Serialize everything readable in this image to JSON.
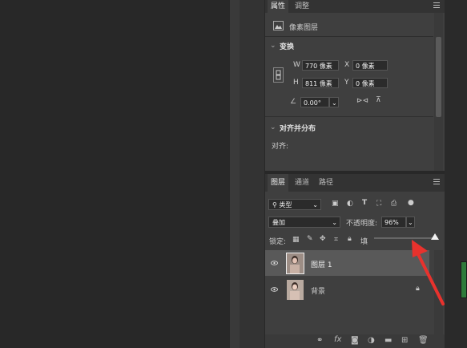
{
  "properties_panel": {
    "tabs": [
      "属性",
      "调整"
    ],
    "layer_kind": "像素图层",
    "transform_title": "变换",
    "w_label": "W",
    "w_value": "770 像素",
    "x_label": "X",
    "x_value": "0 像素",
    "h_label": "H",
    "h_value": "811 像素",
    "y_label": "Y",
    "y_value": "0 像素",
    "angle_value": "0.00°",
    "align_title": "对齐并分布",
    "align_label": "对齐:"
  },
  "layers_panel": {
    "tabs": [
      "图层",
      "通道",
      "路径"
    ],
    "filter_kind": "类型",
    "blend_mode": "叠加",
    "opacity_label": "不透明度:",
    "opacity_value": "96%",
    "lock_label": "锁定:",
    "fill_label": "填",
    "fill_level": 1.0,
    "layers": [
      {
        "name": "图层 1",
        "selected": true,
        "locked": false
      },
      {
        "name": "背景",
        "selected": false,
        "locked": true
      }
    ],
    "bottom_icons": [
      "link-icon",
      "fx-icon",
      "mask-icon",
      "adjustment-icon",
      "group-icon",
      "new-layer-icon",
      "trash-icon"
    ],
    "fx_text": "fx"
  },
  "colors": {
    "arrow": "#e8322d",
    "selected_row": "#595959",
    "panel": "#3f3f3f"
  }
}
